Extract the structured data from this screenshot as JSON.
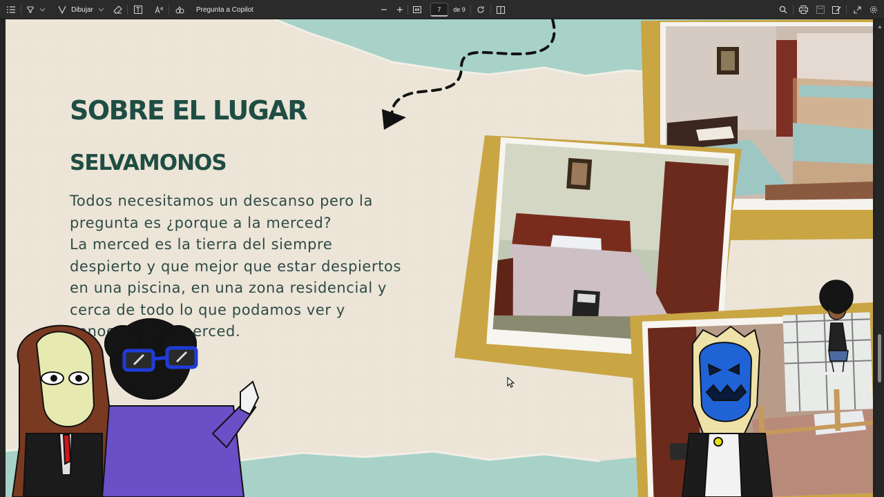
{
  "toolbar": {
    "draw_label": "Dibujar",
    "copilot_label": "Pregunta a Copilot",
    "page_current": "7",
    "page_total": "de 9"
  },
  "slide": {
    "title": "SOBRE EL LUGAR",
    "subtitle": "SELVAMONOS",
    "body_lines": [
      "Todos necesitamos un descanso pero la",
      "pregunta es ¿porque a la merced?",
      "La merced es la tierra del siempre",
      "despierto y que mejor que estar despiertos",
      "en una piscina, en una zona residencial y",
      "cerca de todo lo que podamos ver y",
      "conocer en la merced."
    ]
  },
  "colors": {
    "toolbar_bg": "#2b2b2b",
    "paper": "#ece5d8",
    "teal": "#a8d2c8",
    "heading": "#1f4d43",
    "frame_gold": "#c9a544"
  },
  "icons": [
    "list-icon",
    "highlighter-icon",
    "draw-icon",
    "eraser-icon",
    "text-box-icon",
    "text-read-aloud-icon",
    "copilot-icon",
    "zoom-out-icon",
    "zoom-in-icon",
    "fit-page-icon",
    "rotate-icon",
    "two-page-icon",
    "search-icon",
    "print-icon",
    "save-icon",
    "edit-icon",
    "expand-icon",
    "settings-icon"
  ]
}
